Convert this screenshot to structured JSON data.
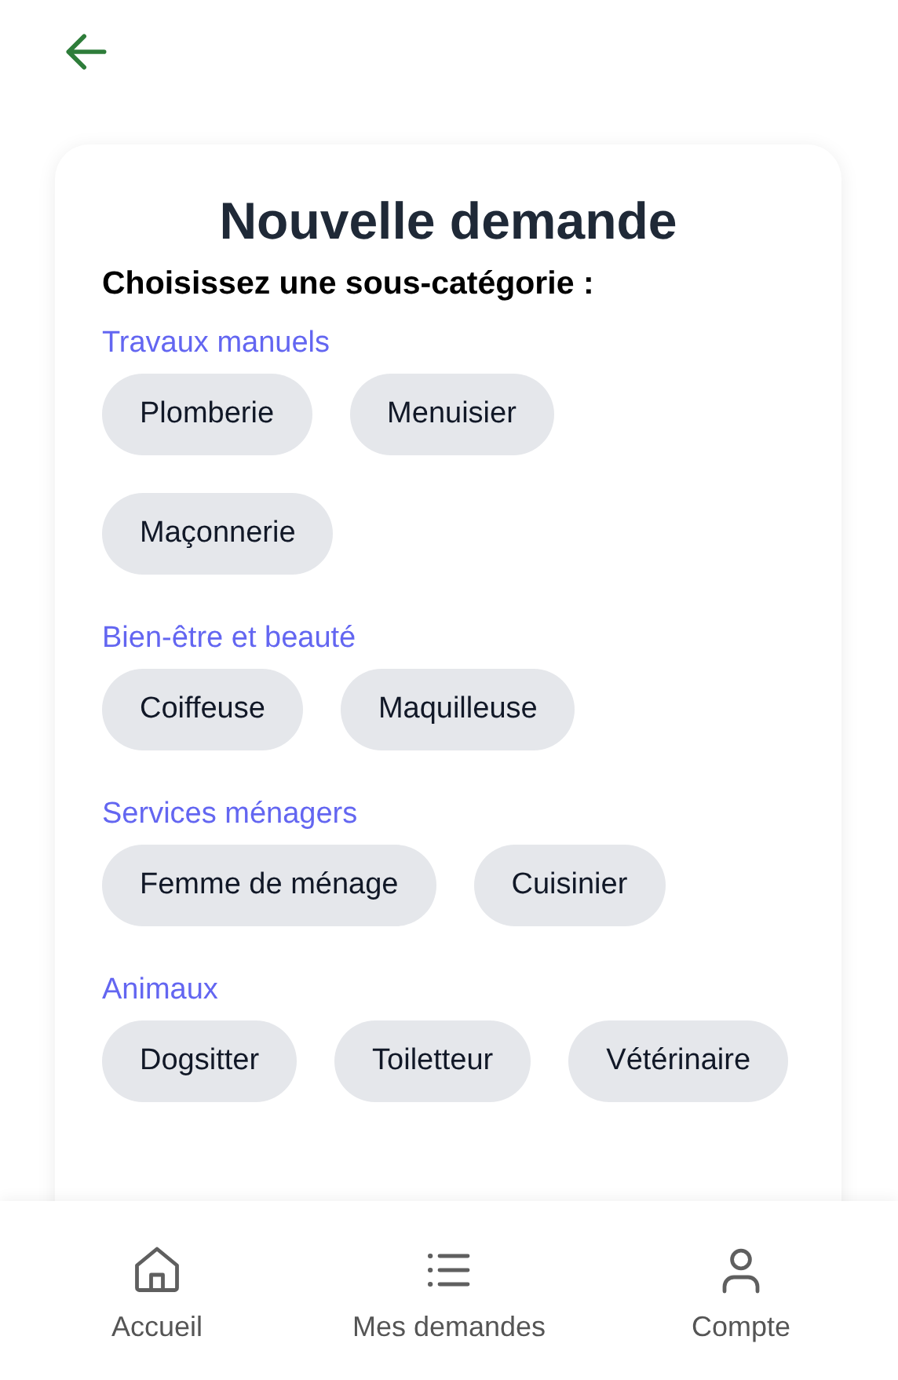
{
  "title": "Nouvelle demande",
  "subtitle": "Choisissez une sous-catégorie :",
  "categories": [
    {
      "label": "Travaux manuels",
      "items": [
        "Plomberie",
        "Menuisier",
        "Maçonnerie"
      ]
    },
    {
      "label": "Bien-être et beauté",
      "items": [
        "Coiffeuse",
        "Maquilleuse"
      ]
    },
    {
      "label": "Services ménagers",
      "items": [
        "Femme de ménage",
        "Cuisinier"
      ]
    },
    {
      "label": "Animaux",
      "items": [
        "Dogsitter",
        "Toiletteur",
        "Vétérinaire"
      ]
    }
  ],
  "nav": [
    {
      "kind": "home",
      "label": "Accueil"
    },
    {
      "kind": "list",
      "label": "Mes demandes"
    },
    {
      "kind": "account",
      "label": "Compte"
    }
  ]
}
